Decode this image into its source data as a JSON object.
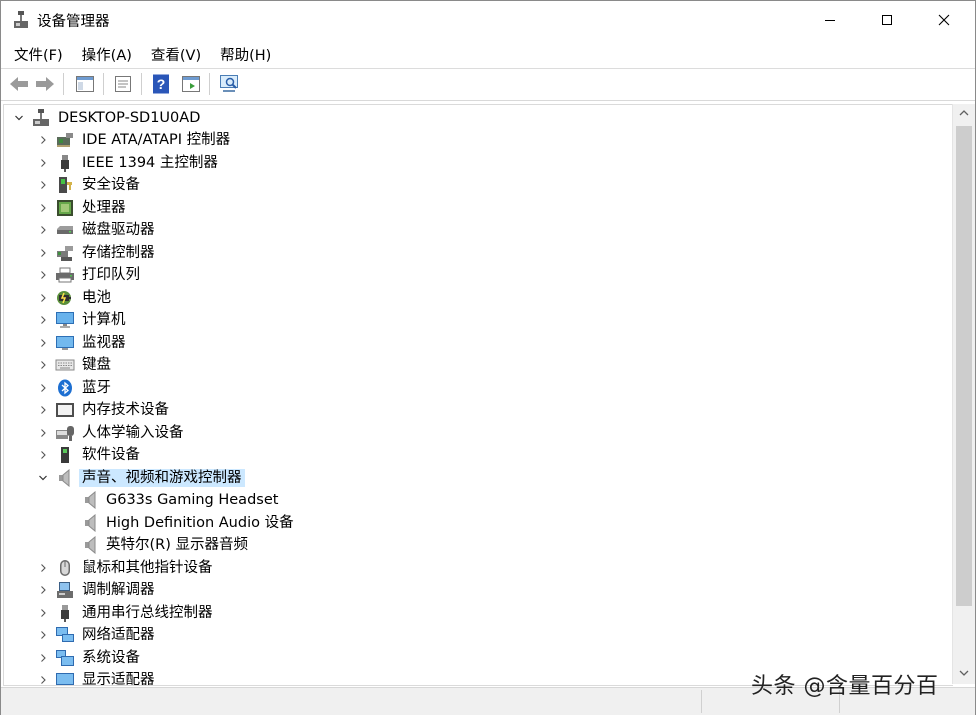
{
  "window": {
    "title": "设备管理器"
  },
  "menubar": {
    "items": [
      "文件(F)",
      "操作(A)",
      "查看(V)",
      "帮助(H)"
    ]
  },
  "tree": {
    "root": "DESKTOP-SD1U0AD",
    "items": [
      {
        "label": "IDE ATA/ATAPI 控制器",
        "icon": "ide-controller-icon"
      },
      {
        "label": "IEEE 1394 主控制器",
        "icon": "ieee1394-icon"
      },
      {
        "label": "安全设备",
        "icon": "security-device-icon"
      },
      {
        "label": "处理器",
        "icon": "processor-icon"
      },
      {
        "label": "磁盘驱动器",
        "icon": "disk-drive-icon"
      },
      {
        "label": "存储控制器",
        "icon": "storage-controller-icon"
      },
      {
        "label": "打印队列",
        "icon": "printer-icon"
      },
      {
        "label": "电池",
        "icon": "battery-icon"
      },
      {
        "label": "计算机",
        "icon": "computer-icon"
      },
      {
        "label": "监视器",
        "icon": "monitor-icon"
      },
      {
        "label": "键盘",
        "icon": "keyboard-icon"
      },
      {
        "label": "蓝牙",
        "icon": "bluetooth-icon"
      },
      {
        "label": "内存技术设备",
        "icon": "memory-device-icon"
      },
      {
        "label": "人体学输入设备",
        "icon": "hid-icon"
      },
      {
        "label": "软件设备",
        "icon": "software-device-icon"
      },
      {
        "label": "声音、视频和游戏控制器",
        "icon": "speaker-icon",
        "expanded": true,
        "selected": true
      },
      {
        "label": "G633s Gaming Headset",
        "icon": "speaker-icon",
        "child": true
      },
      {
        "label": "High Definition Audio 设备",
        "icon": "speaker-icon",
        "child": true
      },
      {
        "label": "英特尔(R) 显示器音频",
        "icon": "speaker-icon",
        "child": true
      },
      {
        "label": "鼠标和其他指针设备",
        "icon": "mouse-icon"
      },
      {
        "label": "调制解调器",
        "icon": "modem-icon"
      },
      {
        "label": "通用串行总线控制器",
        "icon": "usb-icon"
      },
      {
        "label": "网络适配器",
        "icon": "network-adapter-icon"
      },
      {
        "label": "系统设备",
        "icon": "system-device-icon"
      },
      {
        "label": "显示适配器",
        "icon": "display-adapter-icon"
      }
    ]
  },
  "watermark": "头条 @含量百分百",
  "colors": {
    "selection": "#cce8ff",
    "accent": "#1e73c8"
  }
}
